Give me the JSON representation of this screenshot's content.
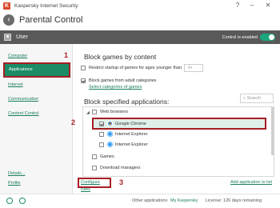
{
  "window": {
    "title": "Kaspersky Internet Security",
    "controls": [
      "?",
      "–",
      "✕"
    ]
  },
  "header": {
    "title": "Parental Control"
  },
  "userbar": {
    "name": "User",
    "control_label": "Control is enabled",
    "control_on": true
  },
  "sidebar": {
    "items": [
      "Computer",
      "Applications",
      "Internet",
      "Communication",
      "Content Control"
    ],
    "active": "Applications",
    "bottom": [
      "Details...",
      "Profile"
    ]
  },
  "content": {
    "block_games_title": "Block games by content",
    "restrict_label": "Restrict startup of games for ages younger than",
    "age_value": "0+",
    "block_adult_label": "Block games from adult categories",
    "select_categories": "Select categories of games",
    "block_apps_title": "Block specified applications:",
    "search_placeholder": "Search"
  },
  "tree": {
    "group": "Web browsers",
    "items": [
      "Google Chrome",
      "Internet Explorer",
      "Internet Explorer"
    ],
    "other_groups": [
      "Games",
      "Download managers"
    ]
  },
  "actions": {
    "configure_rules": "Configure rules",
    "add_app": "Add application to list"
  },
  "annotations": [
    "1",
    "2",
    "3"
  ],
  "statusbar": {
    "other_apps": "Other applications",
    "my_kaspersky": "My Kaspersky",
    "license": "License: 126 days remaining"
  },
  "colors": {
    "accent": "#1b8c66",
    "highlight_border": "#a71d21",
    "userbar": "#595959"
  }
}
